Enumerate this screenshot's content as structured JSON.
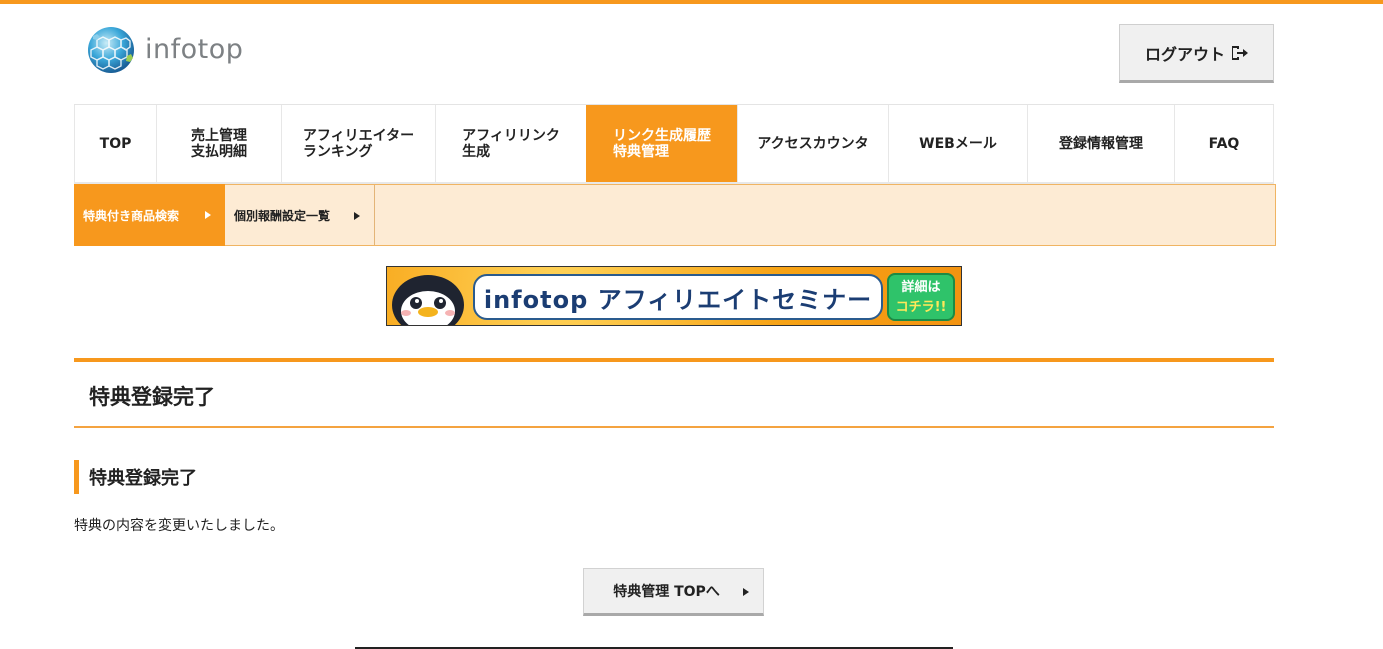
{
  "colors": {
    "accent": "#f7981d",
    "subnav_bg": "#fdebd4",
    "button_bg": "#f0f0f0"
  },
  "header": {
    "logo_text": "infotop",
    "logout_label": "ログアウト"
  },
  "nav": {
    "items": [
      {
        "label": "TOP",
        "active": false
      },
      {
        "label": "売上管理\n支払明細",
        "active": false
      },
      {
        "label": "アフィリエイター\nランキング",
        "active": false
      },
      {
        "label": "アフィリリンク\n生成",
        "active": false
      },
      {
        "label": "リンク生成履歴\n特典管理",
        "active": true
      },
      {
        "label": "アクセスカウンタ",
        "active": false
      },
      {
        "label": "WEBメール",
        "active": false
      },
      {
        "label": "登録情報管理",
        "active": false
      },
      {
        "label": "FAQ",
        "active": false
      }
    ]
  },
  "subnav": {
    "items": [
      {
        "label": "特典付き商品検索",
        "active": true
      },
      {
        "label": "個別報酬設定一覧",
        "active": false
      }
    ]
  },
  "banner": {
    "title": "infotop アフィリエイトセミナー",
    "button_line1": "詳細は",
    "button_line2": "コチラ!!"
  },
  "main": {
    "page_title": "特典登録完了",
    "section_title": "特典登録完了",
    "message": "特典の内容を変更いたしました。",
    "back_button_label": "特典管理 TOPへ"
  }
}
